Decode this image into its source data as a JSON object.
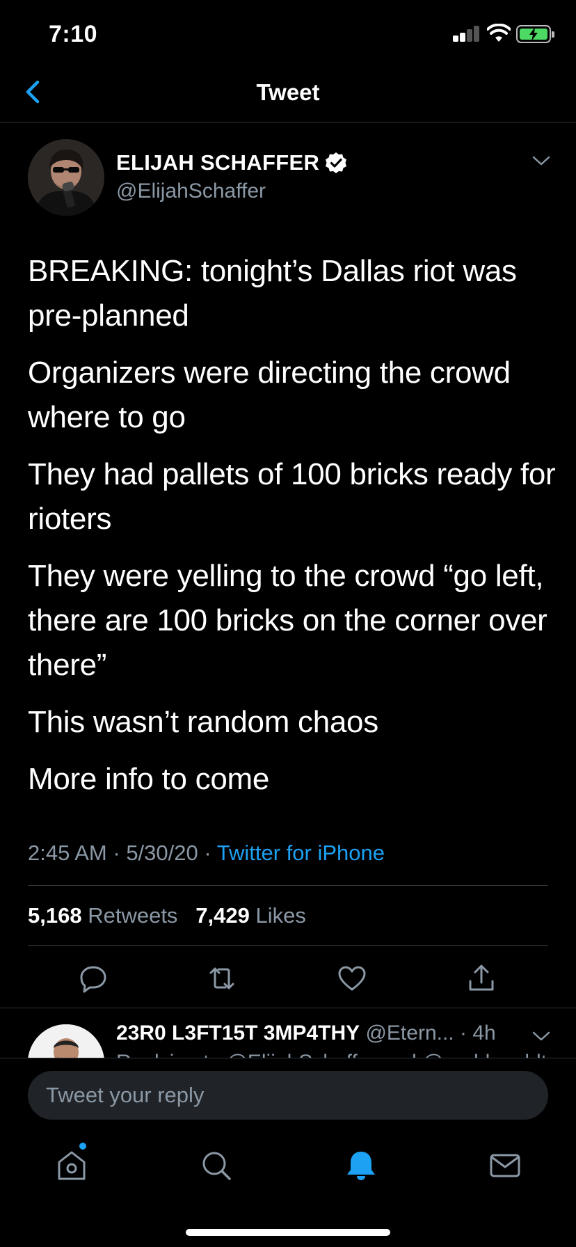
{
  "status_bar": {
    "time": "7:10"
  },
  "nav": {
    "title": "Tweet"
  },
  "tweet": {
    "author_name": "ELIJAH SCHAFFER",
    "handle": "@ElijahSchaffer",
    "paragraphs": [
      "BREAKING: tonight’s Dallas riot was pre-planned",
      "Organizers were directing the crowd where to go",
      "They had pallets of 100 bricks ready for rioters",
      "They were yelling to the crowd “go left, there are 100 bricks on the corner over there”",
      "This wasn’t random chaos",
      "More info to come"
    ],
    "time": "2:45 AM",
    "date": "5/30/20",
    "source": "Twitter for iPhone",
    "retweets_count": "5,168",
    "retweets_label": "Retweets",
    "likes_count": "7,429",
    "likes_label": "Likes"
  },
  "reply": {
    "name": "23R0 L3FT15T 3MP4THY",
    "handle": "@Etern...",
    "age": "4h",
    "peek": "Replying to @ElijahSchaffer and @realdonaldt"
  },
  "composer": {
    "placeholder": "Tweet your reply"
  },
  "colors": {
    "accent": "#1da1f2",
    "secondary_text": "#8b98a5",
    "divider": "#2f3336",
    "battery": "#4cd964"
  },
  "icons": {
    "actions": [
      "reply-icon",
      "retweet-icon",
      "like-icon",
      "share-icon"
    ],
    "tabs": [
      "home-icon",
      "search-icon",
      "notifications-icon",
      "messages-icon"
    ]
  }
}
